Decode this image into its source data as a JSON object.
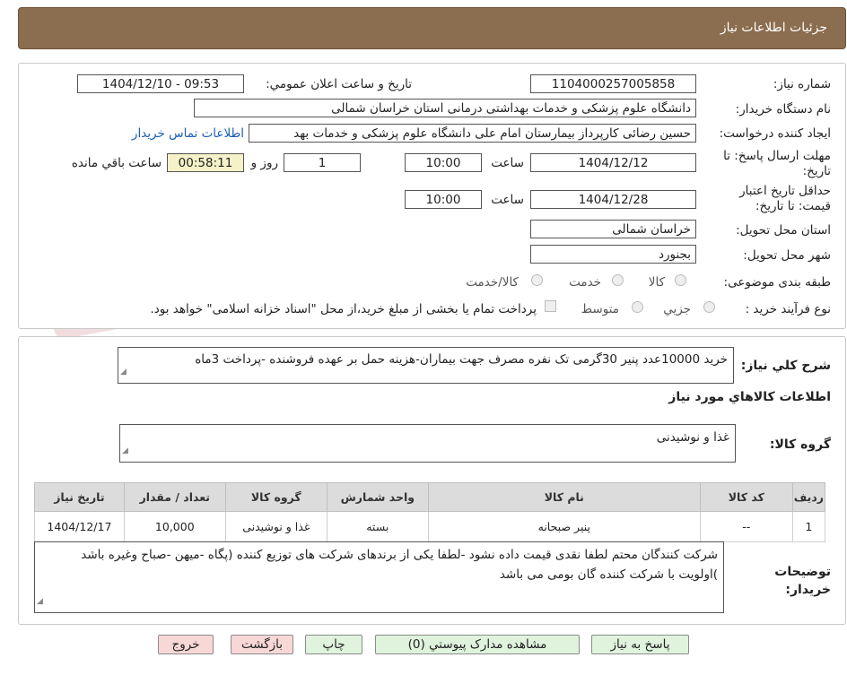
{
  "header": {
    "title": "جزئیات اطلاعات نیاز"
  },
  "form": {
    "need_number_label": "شماره نیاز:",
    "need_number": "1104000257005858",
    "announce_label": "تاریخ و ساعت اعلان عمومي:",
    "announce_value": "1404/12/10 - 09:53",
    "buyer_org_label": "نام دستگاه خريدار:",
    "buyer_org": "دانشگاه علوم پزشکی و خدمات بهداشتی درمانی استان خراسان شمالی",
    "creator_label": "ايجاد کننده درخواست:",
    "creator": "حسین رضائی کارپرداز بیمارستان امام علی دانشگاه علوم پزشکی و خدمات بهد",
    "contact_link": "اطلاعات تماس خريدار",
    "reply_deadline_label": "مهلت ارسال پاسخ: تا تاریخ:",
    "reply_date": "1404/12/12",
    "time_label": "ساعت",
    "reply_time": "10:00",
    "days_value": "1",
    "days_label": "روز و",
    "remaining_time": "00:58:11",
    "remaining_label": "ساعت باقي مانده",
    "validity_label": "حداقل تاريخ اعتبار قيمت: تا تاریخ:",
    "validity_date": "1404/12/28",
    "validity_time": "10:00",
    "province_label": "استان محل تحویل:",
    "province": "خراسان شمالی",
    "city_label": "شهر محل تحویل:",
    "city": "بجنورد",
    "category_label": "طبقه بندی موضوعی:",
    "category_options": [
      "کالا",
      "خدمت",
      "کالا/خدمت"
    ],
    "process_label": "نوع فرآيند خريد :",
    "process_options": [
      "جزیي",
      "متوسط"
    ],
    "payment_note": "پرداخت تمام یا بخشی از مبلغ خرید،از محل \"اسناد خزانه اسلامی\" خواهد بود."
  },
  "summary": {
    "label": "شرح کلي نياز:",
    "text": "خرید 10000عدد پنیر 30گرمی تک نفره مصرف جهت بیماران-هزینه حمل بر عهده فروشنده -پرداخت 3ماه"
  },
  "goods": {
    "section_title": "اطلاعات کالاهاي مورد نياز",
    "group_label": "گروه کالا:",
    "group_value": "غذا و نوشیدنی",
    "columns": [
      "رديف",
      "کد کالا",
      "نام کالا",
      "واحد شمارش",
      "گروه کالا",
      "تعداد / مقدار",
      "تاريخ نياز"
    ],
    "rows": [
      [
        "1",
        "--",
        "پنیر صبحانه",
        "بسته",
        "غذا و نوشیدنی",
        "10,000",
        "1404/12/17"
      ]
    ]
  },
  "notes": {
    "label": "توضيحات خريدار:",
    "text": "شرکت کنندگان محتم لطفا نقدی قیمت داده نشود  -لطفا یکی از برندهای شرکت های توزیع کننده (پگاه -میهن -صباح وغیره باشد )اولویت با شرکت کننده گان بومی می باشد"
  },
  "buttons": {
    "reply": "پاسخ به نياز",
    "attachments": "مشاهده مدارک پيوستي (0)",
    "print": "چاپ",
    "back": "بازگشت",
    "exit": "خروج"
  },
  "watermark": {
    "text": "AriaTender.neT"
  },
  "colors": {
    "header_bg": "#8b6d4f",
    "green_button": "#dff3dd",
    "pink_button": "#f8d7d7",
    "remaining_bg": "#f5f1c8",
    "link": "#1a5fb4"
  }
}
